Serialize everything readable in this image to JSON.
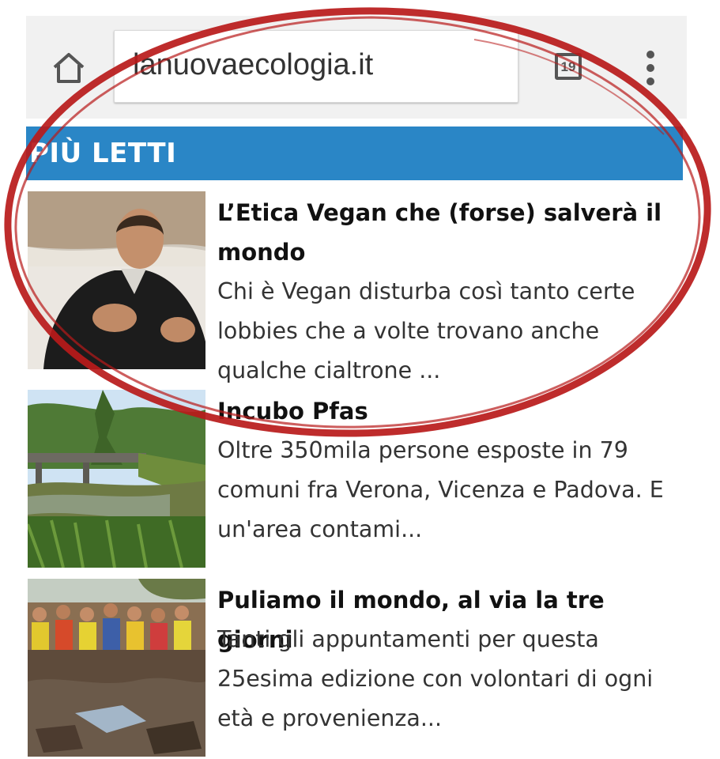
{
  "browser": {
    "url": "lanuovaecologia.it",
    "tabs_count": "19",
    "icons": {
      "home": "home-icon",
      "tabs": "tab-switcher-icon",
      "menu": "overflow-menu-icon"
    }
  },
  "section": {
    "title": "PIÙ LETTI",
    "color": "#2a86c6"
  },
  "articles": [
    {
      "title_line1": "L’Etica Vegan che (forse) salverà il",
      "title_line2": "mondo",
      "desc_line1": "Chi è Vegan disturba così tanto certe",
      "desc_line2": "lobbies che a volte trovano anche",
      "desc_line3": "qualche cialtrone ..."
    },
    {
      "title_line1": "Incubo Pfas",
      "desc_line1": "Oltre 350mila persone esposte in 79",
      "desc_line2": "comuni fra Verona, Vicenza e Padova. E",
      "desc_line3": "un'area contami..."
    },
    {
      "title_line1": "Puliamo il mondo, al via la tre giorni",
      "desc_line1": "Tanti gli appuntamenti per questa",
      "desc_line2": "25esima edizione con volontari di ogni",
      "desc_line3": "età e provenienza..."
    }
  ],
  "annotation_color": "#b81a1a"
}
